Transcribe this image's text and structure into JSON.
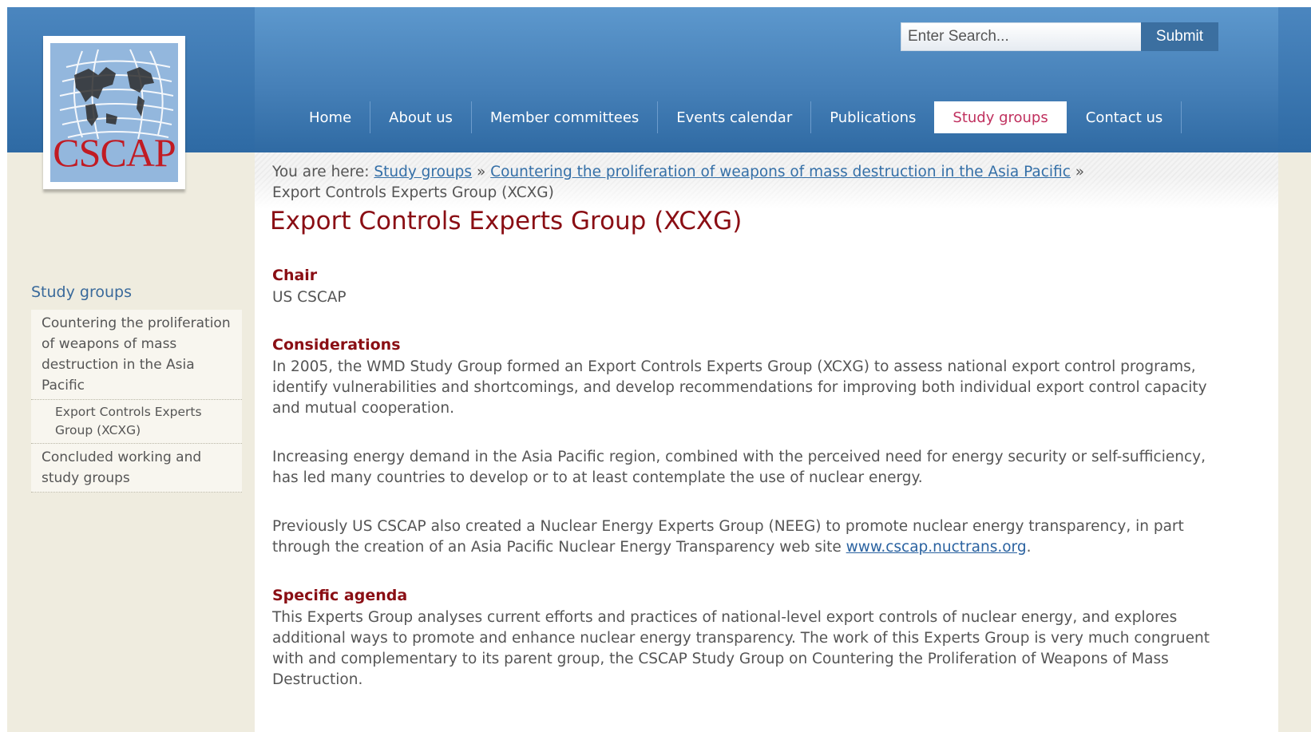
{
  "logo": {
    "text": "CSCAP"
  },
  "search": {
    "placeholder": "Enter Search...",
    "submit_label": "Submit"
  },
  "nav": {
    "items": [
      "Home",
      "About us",
      "Member committees",
      "Events calendar",
      "Publications",
      "Study groups",
      "Contact us"
    ],
    "active": "Study groups"
  },
  "breadcrumb": {
    "prefix": "You are here:",
    "links": [
      "Study groups",
      "Countering the proliferation of weapons of mass destruction in the Asia Pacific"
    ],
    "separator": "»",
    "current": "Export Controls Experts Group (XCXG)"
  },
  "page": {
    "title": "Export Controls Experts Group (XCXG)",
    "chair_heading": "Chair",
    "chair_value": "US CSCAP",
    "considerations_heading": "Considerations",
    "considerations_p1": "In 2005, the WMD Study Group formed an Export Controls Experts Group (XCXG) to assess national export control programs, identify vulnerabilities and shortcomings, and develop recommendations for improving both individual export control capacity and mutual cooperation.",
    "considerations_p2": "Increasing energy demand in the Asia Pacific region, combined with the perceived need for energy security or self-sufficiency, has led many countries to develop or to at least contemplate the use of nuclear energy.",
    "considerations_p3_text": "Previously US CSCAP also created a Nuclear Energy Experts Group (NEEG) to promote nuclear energy transparency, in part through the creation of an Asia Pacific Nuclear Energy Transparency web site",
    "considerations_p3_link": "www.cscap.nuctrans.org",
    "considerations_p3_end": ".",
    "agenda_heading": "Specific agenda",
    "agenda_p1": "This Experts Group analyses current efforts and practices of national-level export controls of nuclear energy, and explores additional ways to promote and enhance nuclear energy transparency. The work of this Experts Group is very much congruent with and complementary to its parent group, the CSCAP Study Group on Countering the Proliferation of Weapons of Mass Destruction."
  },
  "sidebar": {
    "title": "Study groups",
    "items": [
      "Countering the proliferation of weapons of mass destruction in the Asia Pacific",
      "Export Controls Experts Group (XCXG)",
      "Concluded working and study groups"
    ]
  },
  "colors": {
    "header_blue": "#4680b8",
    "title_red": "#8a0e14",
    "active_nav_text": "#c0305e",
    "link_blue": "#346fa7",
    "sidebar_bg": "#efecdf"
  }
}
